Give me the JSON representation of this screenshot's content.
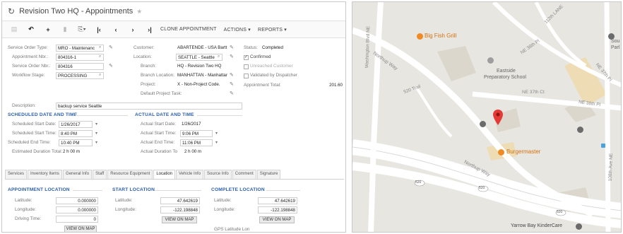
{
  "window": {
    "title": "Revision Two HQ  -  Appointments"
  },
  "toolbar": {
    "clone_label": "CLONE APPOINTMENT",
    "actions_label": "ACTIONS ▾",
    "reports_label": "REPORTS ▾"
  },
  "form": {
    "service_order_type": {
      "label": "Service Order Type:",
      "value": "MRO - Maintenanc"
    },
    "appointment_nbr": {
      "label": "Appointment Nbr.:",
      "value": "804316-1"
    },
    "service_order_nbr": {
      "label": "Service Order Nbr.:",
      "value": "804316"
    },
    "workflow_stage": {
      "label": "Workflow Stage:",
      "value": "PROCESSING"
    },
    "customer": {
      "label": "Customer:",
      "value": "ABARTENDE - USA Bartt"
    },
    "location": {
      "label": "Location:",
      "value": "SEATTLE - Seattle"
    },
    "branch": {
      "label": "Branch:",
      "value": "HQ - Revision Two HQ"
    },
    "branch_location": {
      "label": "Branch Location:",
      "value": "MANHATTAN - Manhattar"
    },
    "project": {
      "label": "Project:",
      "value": "X - Non-Project Code."
    },
    "default_project_task": {
      "label": "Default Project Task:"
    },
    "status": {
      "label": "Status:",
      "value": "Completed"
    },
    "confirmed": {
      "label": "Confirmed"
    },
    "unreached_customer": {
      "label": "Unreached Customer"
    },
    "validated_by_dispatcher": {
      "label": "Validated by Dispatcher"
    },
    "appointment_total": {
      "label": "Appointment Total:",
      "value": "201.60"
    },
    "description": {
      "label": "Description:",
      "value": "backup service Seattle"
    }
  },
  "scheduled": {
    "title": "SCHEDULED DATE AND TIME",
    "start_date": {
      "label": "Scheduled Start Date:",
      "value": "1/26/2017"
    },
    "start_time": {
      "label": "Scheduled Start Time:",
      "value": "8:40 PM"
    },
    "end_time": {
      "label": "Scheduled End Time:",
      "value": "10:40 PM"
    },
    "duration": {
      "label": "Estimated Duration Total:",
      "value": "2 h 00 m"
    }
  },
  "actual": {
    "title": "ACTUAL DATE AND TIME",
    "start_date": {
      "label": "Actual Start Date:",
      "value": "1/26/2017"
    },
    "start_time": {
      "label": "Actual Start Time:",
      "value": "9:06 PM"
    },
    "end_time": {
      "label": "Actual End Time:",
      "value": "11:06 PM"
    },
    "duration": {
      "label": "Actual Duration To",
      "value": "2 h 00 m"
    }
  },
  "tabs": [
    "Services",
    "Inventory Items",
    "General Info",
    "Staff",
    "Resource Equipment",
    "Location",
    "Vehicle Info",
    "Source Info",
    "Comment",
    "Signature"
  ],
  "appointment_location": {
    "title": "APPOINTMENT LOCATION",
    "latitude": {
      "label": "Latitude:",
      "value": "0.000000"
    },
    "longitude": {
      "label": "Longitude:",
      "value": "0.000000"
    },
    "driving_time": {
      "label": "Driving Time:",
      "value": "0"
    },
    "view_button": "VIEW ON MAP"
  },
  "start_location": {
    "title": "START LOCATION",
    "latitude": {
      "label": "Latitude:",
      "value": "47.642619"
    },
    "longitude": {
      "label": "Longitude:",
      "value": "-122.198848"
    },
    "view_button": "VIEW ON MAP"
  },
  "complete_location": {
    "title": "COMPLETE LOCATION",
    "latitude": {
      "label": "Latitude:",
      "value": "47.642619"
    },
    "longitude": {
      "label": "Longitude:",
      "value": "-122.198848"
    },
    "view_button": "VIEW ON MAP",
    "gps_label": "GPS Latitude Lon"
  },
  "map": {
    "colors": {
      "land": "#e8e6e1",
      "road": "#ffffff",
      "building": "#dcd7cd",
      "poi_orange": "#f08a24",
      "pin": "#e53935",
      "label": "#7a7a7a"
    },
    "labels": {
      "big_fish_grill": "Big Fish Grill",
      "eastside_prep_1": "Eastside",
      "eastside_prep_2": "Preparatory School",
      "burgermaster": "Burgermaster",
      "yarrow_bay": "Yarrow Bay KinderCare",
      "northup_way_top": "Northup Way",
      "northup_way_mid": "Northup Way",
      "ne_38th": "NE 38th Pl",
      "ne_37th": "NE 37th Ct",
      "ne_38th_right": "NE 38th Pl",
      "ne_37th_right": "NE 37th Pl",
      "trail_520": "520 Trail",
      "washington_blvd": "Washington Blvd NE",
      "ave_108th": "108th Ave NE",
      "lane_112": "112th LANE",
      "souf_1": "Sou",
      "souf_2": "Parl"
    },
    "route_badge": "520"
  }
}
